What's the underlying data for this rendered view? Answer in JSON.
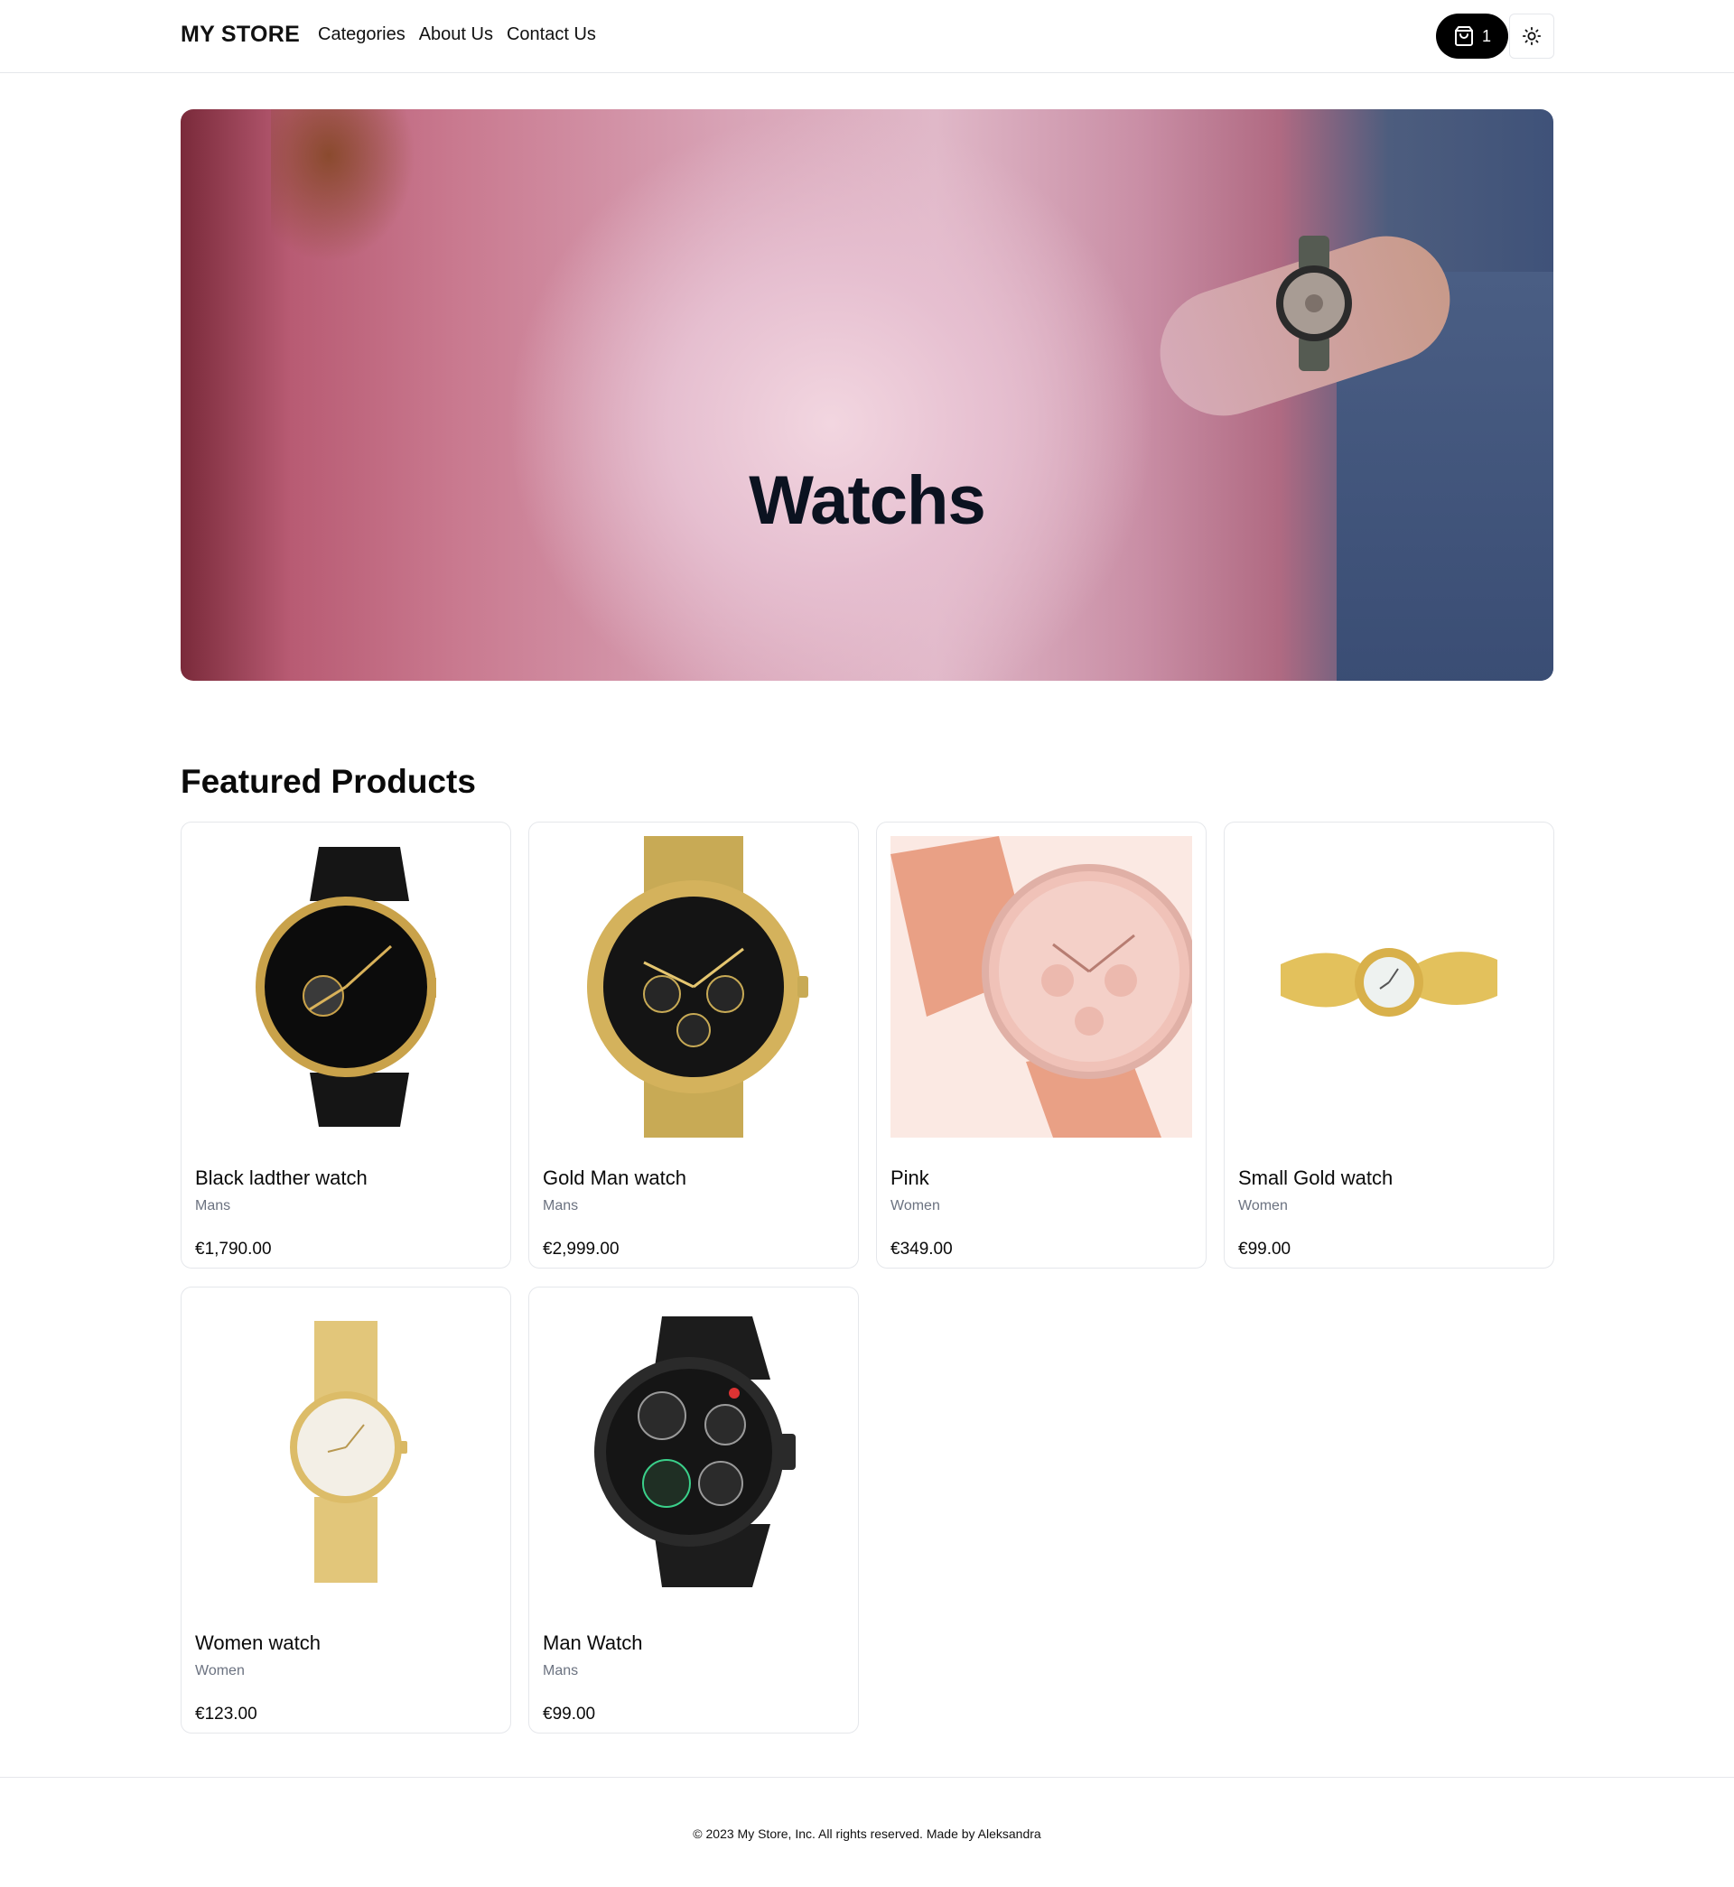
{
  "header": {
    "logo": "MY STORE",
    "nav": [
      "Categories",
      "About Us",
      "Contact Us"
    ],
    "cart_count": "1"
  },
  "hero": {
    "title": "Watchs"
  },
  "featured": {
    "title": "Featured Products",
    "products": [
      {
        "name": "Black ladther watch",
        "category": "Mans",
        "price": "€1,790.00"
      },
      {
        "name": "Gold Man watch",
        "category": "Mans",
        "price": "€2,999.00"
      },
      {
        "name": "Pink",
        "category": "Women",
        "price": "€349.00"
      },
      {
        "name": "Small Gold watch",
        "category": "Women",
        "price": "€99.00"
      },
      {
        "name": "Women watch",
        "category": "Women",
        "price": "€123.00"
      },
      {
        "name": "Man Watch",
        "category": "Mans",
        "price": "€99.00"
      }
    ]
  },
  "footer": {
    "text": "© 2023 My Store, Inc. All rights reserved. Made by Aleksandra"
  },
  "colors": {
    "accent": "#000000",
    "border": "#e5e7eb",
    "muted": "#6b7280"
  }
}
